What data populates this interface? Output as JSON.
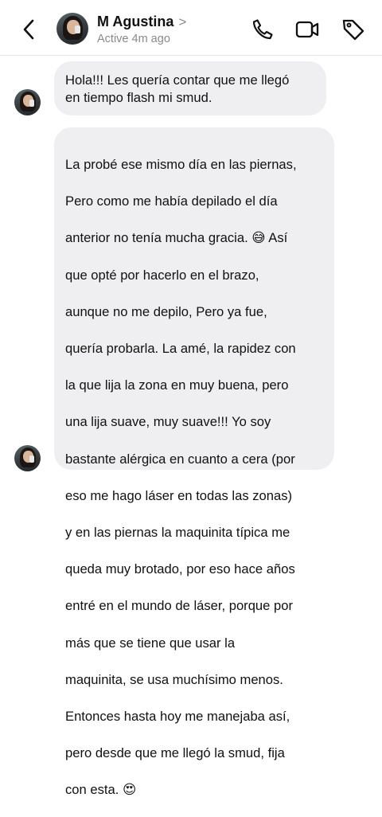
{
  "header": {
    "contact_name": "M Agustina",
    "name_chevron": ">",
    "status": "Active 4m ago",
    "icons": {
      "back": "chevron-left-icon",
      "call": "phone-icon",
      "video": "video-camera-icon",
      "tag": "tag-icon"
    }
  },
  "messages": [
    {
      "sender": "M Agustina",
      "text": "Hola!!! Les quería contar que me llegó\nen tiempo flash mi smud."
    },
    {
      "sender": "M Agustina",
      "lines": [
        "La probé ese mismo día en las piernas,",
        "Pero como me había depilado el día",
        "anterior no tenía mucha gracia. 😅 Así",
        "que opté por hacerlo en el brazo,",
        "aunque no me depilo, Pero ya fue,",
        "quería probarla. La amé, la rapidez con",
        "la que lija la zona en muy buena, pero",
        "una lija suave, muy suave!!! Yo soy",
        "bastante alérgica en cuanto a cera (por",
        "eso me hago láser en todas las zonas)",
        "y en las piernas la maquinita típica me",
        "queda muy brotado, por eso hace años",
        "entré en el mundo de láser, porque por",
        "más que se tiene que usar la",
        "maquinita, se usa muchísimo menos.",
        "Entonces hasta hoy me manejaba así,",
        "pero desde que me llegó la smud, fija",
        "con esta. 😍"
      ]
    }
  ]
}
